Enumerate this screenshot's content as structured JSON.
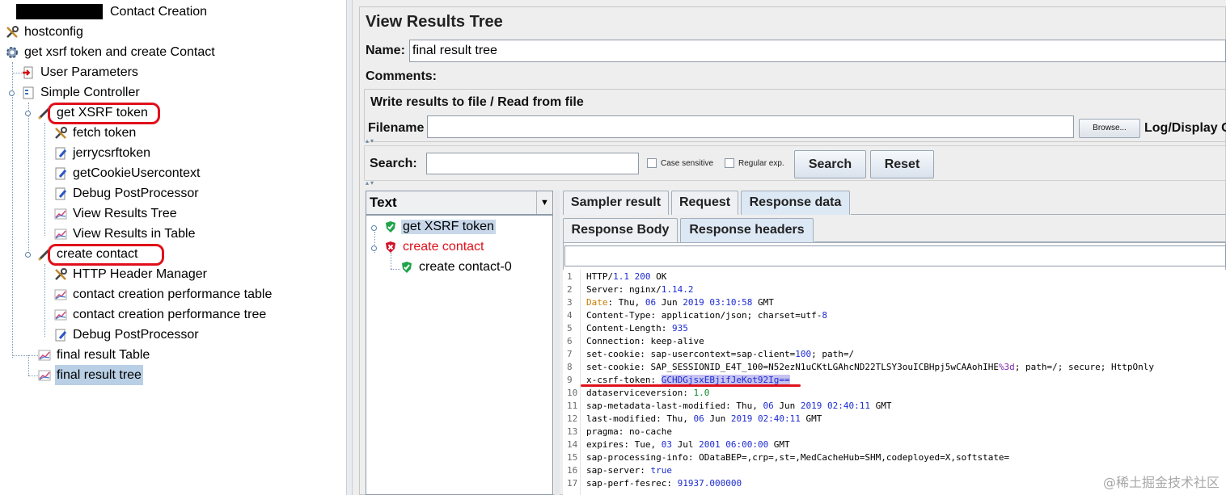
{
  "left_tree": {
    "items": [
      {
        "label": "Contact Creation",
        "icon": "test-plan-icon"
      },
      {
        "label": "hostconfig",
        "icon": "wrench-icon"
      },
      {
        "label": "get xsrf token and create Contact",
        "icon": "gear-icon"
      },
      {
        "label": "User Parameters",
        "icon": "preprocessor-icon"
      },
      {
        "label": "Simple Controller",
        "icon": "controller-icon"
      },
      {
        "label": "get XSRF token",
        "icon": "sampler-pen-icon"
      },
      {
        "label": "fetch token",
        "icon": "wrench-icon"
      },
      {
        "label": "jerrycsrftoken",
        "icon": "postprocessor-icon"
      },
      {
        "label": "getCookieUsercontext",
        "icon": "postprocessor-icon"
      },
      {
        "label": "Debug PostProcessor",
        "icon": "postprocessor-icon"
      },
      {
        "label": "View Results Tree",
        "icon": "listener-chart-icon"
      },
      {
        "label": "View Results in Table",
        "icon": "listener-chart-icon"
      },
      {
        "label": "create contact",
        "icon": "sampler-pen-icon"
      },
      {
        "label": "HTTP Header Manager",
        "icon": "wrench-icon"
      },
      {
        "label": "contact creation performance table",
        "icon": "listener-chart-icon"
      },
      {
        "label": "contact creation performance tree",
        "icon": "listener-chart-icon"
      },
      {
        "label": "Debug PostProcessor",
        "icon": "postprocessor-icon"
      },
      {
        "label": "final result Table",
        "icon": "listener-chart-icon"
      },
      {
        "label": "final result tree",
        "icon": "listener-chart-icon"
      }
    ]
  },
  "panel": {
    "title": "View Results Tree",
    "name_label": "Name:",
    "name_value": "final result tree",
    "comments_label": "Comments:",
    "file_group_title": "Write results to file / Read from file",
    "filename_label": "Filename",
    "filename_value": "",
    "browse_label": "Browse...",
    "log_display_label": "Log/Display C"
  },
  "search": {
    "label": "Search:",
    "value": "",
    "case_sensitive": "Case sensitive",
    "regular_exp": "Regular exp.",
    "search_button": "Search",
    "reset_button": "Reset"
  },
  "renderer": {
    "selected": "Text"
  },
  "result_tree": [
    {
      "label": "get XSRF token",
      "status": "success"
    },
    {
      "label": "create contact",
      "status": "error"
    },
    {
      "label": "create contact-0",
      "status": "success"
    }
  ],
  "tabs": {
    "main": [
      "Sampler result",
      "Request",
      "Response data"
    ],
    "main_active": "Response data",
    "sub": [
      "Response Body",
      "Response headers"
    ],
    "sub_active": "Response headers"
  },
  "response_lines": [
    {
      "n": "1",
      "parts": [
        [
          "k",
          "HTTP/"
        ],
        [
          "kblue",
          "1.1"
        ],
        [
          "k",
          " "
        ],
        [
          "kblue",
          "200"
        ],
        [
          "k",
          " OK"
        ]
      ]
    },
    {
      "n": "2",
      "parts": [
        [
          "k",
          "Server: nginx/"
        ],
        [
          "kblue",
          "1.14.2"
        ]
      ]
    },
    {
      "n": "3",
      "parts": [
        [
          "korange",
          "Date"
        ],
        [
          "k",
          ": Thu, "
        ],
        [
          "kblue",
          "06"
        ],
        [
          "k",
          " Jun "
        ],
        [
          "kblue",
          "2019 03:10:58"
        ],
        [
          "k",
          " GMT"
        ]
      ]
    },
    {
      "n": "4",
      "parts": [
        [
          "k",
          "Content-Type: application/json; charset=utf-"
        ],
        [
          "kblue",
          "8"
        ]
      ]
    },
    {
      "n": "5",
      "parts": [
        [
          "k",
          "Content-Length: "
        ],
        [
          "kblue",
          "935"
        ]
      ]
    },
    {
      "n": "6",
      "parts": [
        [
          "k",
          "Connection: keep-alive"
        ]
      ]
    },
    {
      "n": "7",
      "parts": [
        [
          "k",
          "set-cookie: sap-usercontext=sap-client="
        ],
        [
          "kblue",
          "100"
        ],
        [
          "k",
          "; path=/"
        ]
      ]
    },
    {
      "n": "8",
      "parts": [
        [
          "k",
          "set-cookie: SAP_SESSIONID_E4T_100=N52ezN1uCKtLGAhcND22TLSY3ouICBHpj5wCAAohIHE"
        ],
        [
          "kpur",
          "%3d"
        ],
        [
          "k",
          "; path=/; secure; HttpOnly"
        ]
      ]
    },
    {
      "n": "9",
      "parts": [
        [
          "k",
          "x-csrf-token: "
        ],
        [
          "tokhl",
          "GCHDGjsxEBjifJeKot92Ig=="
        ]
      ]
    },
    {
      "n": "10",
      "parts": [
        [
          "k",
          "dataserviceversion: "
        ],
        [
          "kgreen",
          "1.0"
        ]
      ]
    },
    {
      "n": "11",
      "parts": [
        [
          "k",
          "sap-metadata-last-modified: Thu, "
        ],
        [
          "kblue",
          "06"
        ],
        [
          "k",
          " Jun "
        ],
        [
          "kblue",
          "2019 02:40:11"
        ],
        [
          "k",
          " GMT"
        ]
      ]
    },
    {
      "n": "12",
      "parts": [
        [
          "k",
          "last-modified: Thu, "
        ],
        [
          "kblue",
          "06"
        ],
        [
          "k",
          " Jun "
        ],
        [
          "kblue",
          "2019 02:40:11"
        ],
        [
          "k",
          " GMT"
        ]
      ]
    },
    {
      "n": "13",
      "parts": [
        [
          "k",
          "pragma: no-cache"
        ]
      ]
    },
    {
      "n": "14",
      "parts": [
        [
          "k",
          "expires: Tue, "
        ],
        [
          "kblue",
          "03"
        ],
        [
          "k",
          " Jul "
        ],
        [
          "kblue",
          "2001 06:00:00"
        ],
        [
          "k",
          " GMT"
        ]
      ]
    },
    {
      "n": "15",
      "parts": [
        [
          "k",
          "sap-processing-info: ODataBEP=,crp=,st=,MedCacheHub=SHM,codeployed=X,softstate="
        ]
      ]
    },
    {
      "n": "16",
      "parts": [
        [
          "k",
          "sap-server: "
        ],
        [
          "kblue",
          "true"
        ]
      ]
    },
    {
      "n": "17",
      "parts": [
        [
          "k",
          "sap-perf-fesrec: "
        ],
        [
          "kblue",
          "91937.000000"
        ]
      ]
    }
  ],
  "watermark": "@稀土掘金技术社区",
  "colors": {
    "highlight_ring": "#e0101a",
    "selection": "#b8cfe5",
    "error_text": "#e0101a"
  }
}
